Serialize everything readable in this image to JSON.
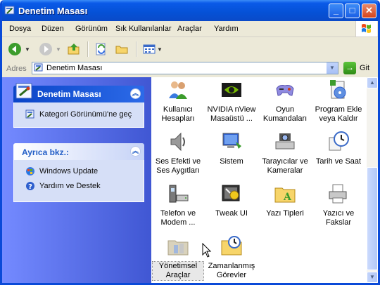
{
  "window": {
    "title": "Denetim Masası",
    "min_glyph": "_",
    "max_glyph": "□",
    "close_glyph": "✕"
  },
  "menu": {
    "items": [
      "Dosya",
      "Düzen",
      "Görünüm",
      "Sık Kullanılanlar",
      "Araçlar",
      "Yardım"
    ]
  },
  "address": {
    "label": "Adres",
    "value": "Denetim Masası",
    "go_label": "Git"
  },
  "left_panes": {
    "control_panel": {
      "title": "Denetim Masası",
      "link": "Kategori Görünümü'ne geç"
    },
    "see_also": {
      "title": "Ayrıca bkz.:",
      "links": [
        "Windows Update",
        "Yardım ve Destek"
      ]
    }
  },
  "items": [
    {
      "line1": "Kullanıcı",
      "line2": "Hesapları",
      "icon": "users-icon"
    },
    {
      "line1": "NVIDIA nView",
      "line2": "Masaüstü ...",
      "icon": "nvidia-icon"
    },
    {
      "line1": "Oyun",
      "line2": "Kumandaları",
      "icon": "gamepad-icon"
    },
    {
      "line1": "Program Ekle",
      "line2": "veya Kaldır",
      "icon": "add-remove-icon"
    },
    {
      "line1": "Ses Efekti ve",
      "line2": "Ses Aygıtları",
      "icon": "speaker-icon"
    },
    {
      "line1": "Sistem",
      "line2": "",
      "icon": "system-icon"
    },
    {
      "line1": "Tarayıcılar ve",
      "line2": "Kameralar",
      "icon": "scanner-icon"
    },
    {
      "line1": "Tarih ve Saat",
      "line2": "",
      "icon": "clock-icon"
    },
    {
      "line1": "Telefon ve",
      "line2": "Modem ...",
      "icon": "phone-icon"
    },
    {
      "line1": "Tweak UI",
      "line2": "",
      "icon": "tweakui-icon"
    },
    {
      "line1": "Yazı Tipleri",
      "line2": "",
      "icon": "fonts-icon"
    },
    {
      "line1": "Yazıcı ve",
      "line2": "Fakslar",
      "icon": "printer-icon"
    },
    {
      "line1": "Yönetimsel",
      "line2": "Araçlar",
      "icon": "admin-tools-icon"
    },
    {
      "line1": "Zamanlanmış",
      "line2": "Görevler",
      "icon": "scheduled-tasks-icon"
    }
  ],
  "colors": {
    "titlebar": "#0a5ae8",
    "left_pane": "#4057d3",
    "panel_body": "#d6dff7"
  }
}
